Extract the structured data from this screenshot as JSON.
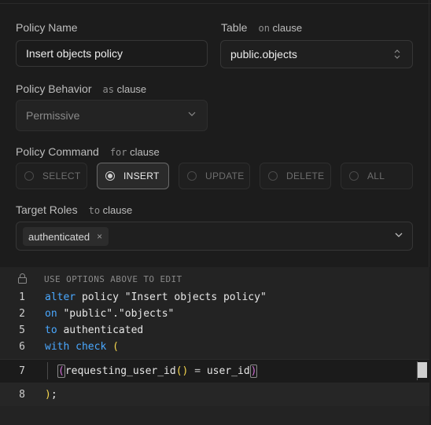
{
  "policy_name": {
    "label": "Policy Name",
    "value": "Insert objects policy"
  },
  "table": {
    "label": "Table",
    "clause_kw": "on",
    "clause_word": "clause",
    "value": "public.objects"
  },
  "policy_behavior": {
    "label": "Policy Behavior",
    "clause_kw": "as",
    "clause_word": "clause",
    "value": "Permissive"
  },
  "policy_command": {
    "label": "Policy Command",
    "clause_kw": "for",
    "clause_word": "clause",
    "options": [
      "SELECT",
      "INSERT",
      "UPDATE",
      "DELETE",
      "ALL"
    ],
    "selected": "INSERT"
  },
  "target_roles": {
    "label": "Target Roles",
    "clause_kw": "to",
    "clause_word": "clause",
    "tags": [
      "authenticated"
    ],
    "remove_glyph": "×"
  },
  "editor": {
    "hint": "USE OPTIONS ABOVE TO EDIT",
    "line_numbers": [
      "1",
      "2",
      "5",
      "6",
      "7",
      "8"
    ],
    "l1_kw": "alter",
    "l1_rest": " policy \"Insert objects policy\"",
    "l2_kw": "on",
    "l2_rest": " \"public\".\"objects\"",
    "l5_kw": "to",
    "l5_rest": " authenticated",
    "l6_kw1": "with",
    "l6_kw2": "check",
    "l6_paren": "(",
    "l7_open": "(",
    "l7_fn": "requesting_user_id",
    "l7_call": "()",
    "l7_eq": " = ",
    "l7_col": "user_id",
    "l7_close": ")",
    "l8_close": ")",
    "l8_semi": ";"
  },
  "colors": {
    "keyword": "#4aa8ff",
    "paren_yellow": "#f5d64e",
    "paren_pink": "#d16ed6"
  }
}
